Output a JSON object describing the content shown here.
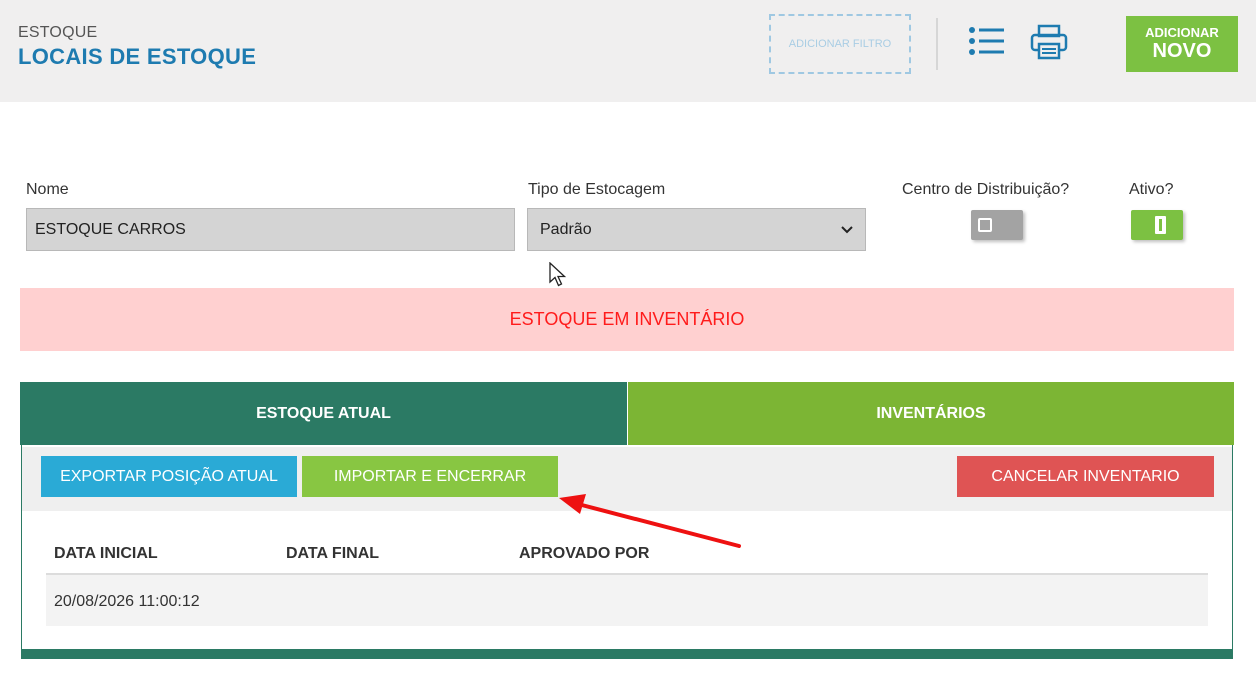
{
  "header": {
    "breadcrumb": "ESTOQUE",
    "title": "LOCAIS DE ESTOQUE",
    "filter_button": "ADICIONAR FILTRO",
    "list_icon": "list-icon",
    "print_icon": "printer-icon",
    "add_button_line1": "ADICIONAR",
    "add_button_line2": "NOVO"
  },
  "form": {
    "name_label": "Nome",
    "name_value": "ESTOQUE CARROS",
    "type_label": "Tipo de Estocagem",
    "type_value": "Padrão",
    "distribution_label": "Centro de Distribuição?",
    "distribution_on": false,
    "active_label": "Ativo?",
    "active_on": true
  },
  "banner": {
    "text": "ESTOQUE EM INVENTÁRIO"
  },
  "tabs": [
    {
      "label": "ESTOQUE ATUAL"
    },
    {
      "label": "INVENTÁRIOS"
    }
  ],
  "toolbar": {
    "export_label": "EXPORTAR POSIÇÃO ATUAL",
    "import_label": "IMPORTAR E ENCERRAR",
    "cancel_label": "CANCELAR INVENTARIO"
  },
  "table": {
    "columns": [
      "DATA INICIAL",
      "DATA FINAL",
      "APROVADO POR"
    ],
    "rows": [
      {
        "data_inicial": "20/08/2026 11:00:12",
        "data_final": "",
        "aprovado_por": ""
      }
    ]
  },
  "colors": {
    "brand_blue": "#1e7bb0",
    "green": "#7cc142",
    "dark_green": "#2b7a64",
    "alert_red": "#ff1b1b",
    "annotation_arrow": "#ee1111"
  }
}
